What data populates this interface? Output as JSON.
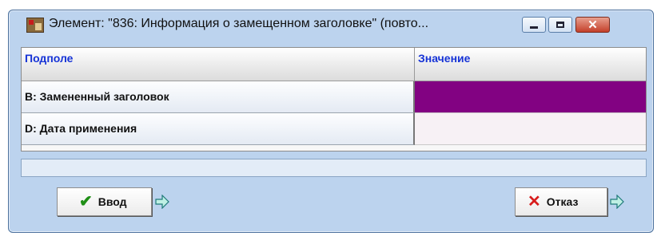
{
  "window": {
    "title": "Элемент: \"836: Информация о замещенном заголовке\" (повто...",
    "icon": "app-books-icon",
    "controls": {
      "minimize": "minimize-icon",
      "maximize": "maximize-icon",
      "close": "close-icon"
    }
  },
  "grid": {
    "headers": [
      "Подполе",
      "Значение"
    ],
    "rows": [
      {
        "subfield": "B: Замененный заголовок",
        "value": "",
        "value_color": "#820282"
      },
      {
        "subfield": "D: Дата применения",
        "value": "",
        "value_color": "#f7f1f5"
      }
    ]
  },
  "status": {
    "text": ""
  },
  "buttons": {
    "ok": {
      "label": "Ввод",
      "icon": "checkmark-icon",
      "arrow_icon": "arrow-right-icon"
    },
    "cancel": {
      "label": "Отказ",
      "icon": "x-icon",
      "arrow_icon": "arrow-right-icon"
    }
  },
  "colors": {
    "header_text": "#1633d6",
    "window_bg": "#bcd3ee",
    "selected_value": "#820282"
  }
}
